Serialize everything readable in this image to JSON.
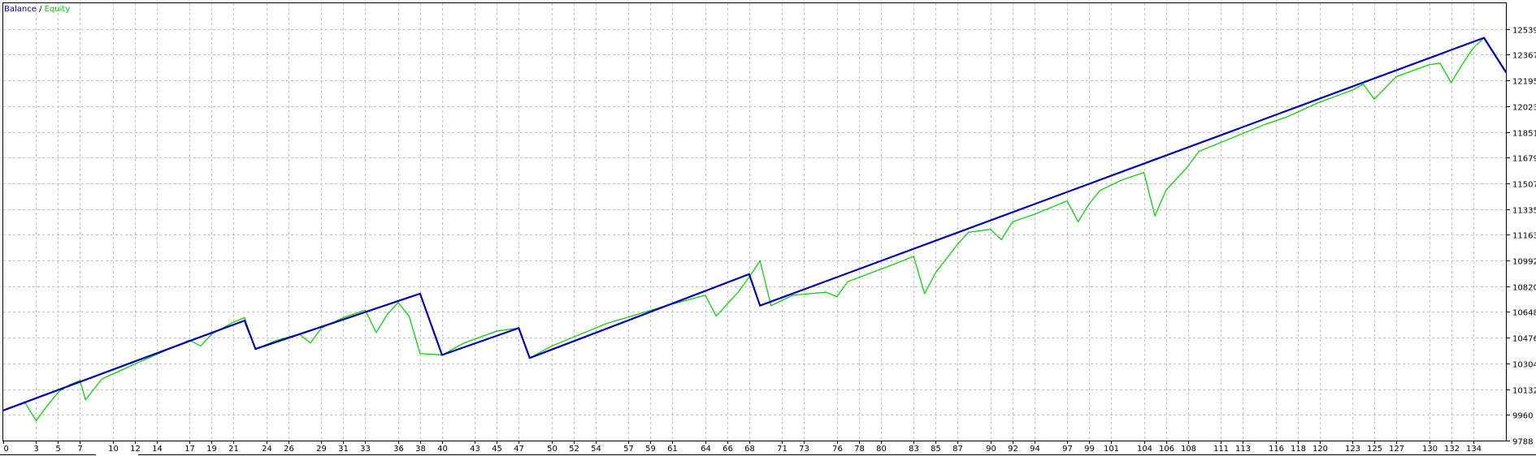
{
  "legend": {
    "balance_label": "Balance",
    "separator": " / ",
    "equity_label": "Equity"
  },
  "colors": {
    "balance": "#0000aa",
    "equity": "#00c800",
    "grid": "#c0c0c0",
    "frame": "#000000",
    "background": "#ffffff"
  },
  "chart_data": {
    "type": "line",
    "title": "",
    "xlabel": "",
    "ylabel": "",
    "grid": true,
    "legend_position": "top-left",
    "xlim": [
      0,
      137
    ],
    "ylim": [
      9788,
      12711
    ],
    "x_ticks": [
      0,
      3,
      5,
      7,
      10,
      12,
      14,
      17,
      19,
      21,
      24,
      26,
      29,
      31,
      33,
      36,
      38,
      40,
      43,
      45,
      47,
      50,
      52,
      54,
      57,
      59,
      61,
      64,
      66,
      68,
      71,
      73,
      76,
      78,
      80,
      83,
      85,
      87,
      90,
      92,
      94,
      97,
      99,
      101,
      104,
      106,
      108,
      111,
      113,
      116,
      118,
      120,
      123,
      125,
      127,
      130,
      132,
      134
    ],
    "y_ticks": [
      9788,
      9960,
      10132,
      10304,
      10476,
      10648,
      10820,
      10992,
      11163,
      11335,
      11507,
      11679,
      11851,
      12023,
      12195,
      12367,
      12539
    ],
    "series": [
      {
        "name": "Balance",
        "points": [
          [
            0,
            9990
          ],
          [
            22,
            10590
          ],
          [
            23,
            10400
          ],
          [
            38,
            10770
          ],
          [
            40,
            10360
          ],
          [
            47,
            10540
          ],
          [
            48,
            10340
          ],
          [
            68,
            10900
          ],
          [
            69,
            10690
          ],
          [
            135,
            12480
          ],
          [
            137,
            12250
          ]
        ]
      },
      {
        "name": "Equity",
        "points": [
          [
            0,
            9990
          ],
          [
            2,
            10040
          ],
          [
            3,
            9920
          ],
          [
            4,
            10020
          ],
          [
            5,
            10110
          ],
          [
            6,
            10160
          ],
          [
            7,
            10190
          ],
          [
            7.5,
            10060
          ],
          [
            9,
            10200
          ],
          [
            12,
            10300
          ],
          [
            17,
            10460
          ],
          [
            18,
            10420
          ],
          [
            19,
            10500
          ],
          [
            21,
            10580
          ],
          [
            22,
            10610
          ],
          [
            23,
            10400
          ],
          [
            25,
            10460
          ],
          [
            27,
            10500
          ],
          [
            28,
            10440
          ],
          [
            29,
            10540
          ],
          [
            31,
            10610
          ],
          [
            33,
            10660
          ],
          [
            34,
            10510
          ],
          [
            35,
            10630
          ],
          [
            36,
            10710
          ],
          [
            37,
            10620
          ],
          [
            38,
            10370
          ],
          [
            40,
            10360
          ],
          [
            42,
            10440
          ],
          [
            45,
            10520
          ],
          [
            47,
            10540
          ],
          [
            48,
            10340
          ],
          [
            50,
            10420
          ],
          [
            55,
            10570
          ],
          [
            60,
            10680
          ],
          [
            64,
            10760
          ],
          [
            65,
            10620
          ],
          [
            67,
            10780
          ],
          [
            68,
            10880
          ],
          [
            69,
            10990
          ],
          [
            70,
            10690
          ],
          [
            72,
            10760
          ],
          [
            75,
            10780
          ],
          [
            76,
            10750
          ],
          [
            77,
            10850
          ],
          [
            82,
            10990
          ],
          [
            83,
            11020
          ],
          [
            84,
            10770
          ],
          [
            85,
            10910
          ],
          [
            87,
            11100
          ],
          [
            88,
            11180
          ],
          [
            90,
            11200
          ],
          [
            91,
            11130
          ],
          [
            92,
            11250
          ],
          [
            94,
            11300
          ],
          [
            97,
            11390
          ],
          [
            98,
            11250
          ],
          [
            99,
            11370
          ],
          [
            100,
            11460
          ],
          [
            102,
            11530
          ],
          [
            104,
            11580
          ],
          [
            105,
            11290
          ],
          [
            106,
            11460
          ],
          [
            108,
            11620
          ],
          [
            109,
            11720
          ],
          [
            115,
            11900
          ],
          [
            117,
            11950
          ],
          [
            120,
            12050
          ],
          [
            123,
            12130
          ],
          [
            124,
            12170
          ],
          [
            125,
            12070
          ],
          [
            127,
            12220
          ],
          [
            130,
            12300
          ],
          [
            131,
            12310
          ],
          [
            132,
            12180
          ],
          [
            133,
            12300
          ],
          [
            134,
            12410
          ],
          [
            135,
            12480
          ],
          [
            137,
            12250
          ]
        ]
      }
    ]
  }
}
